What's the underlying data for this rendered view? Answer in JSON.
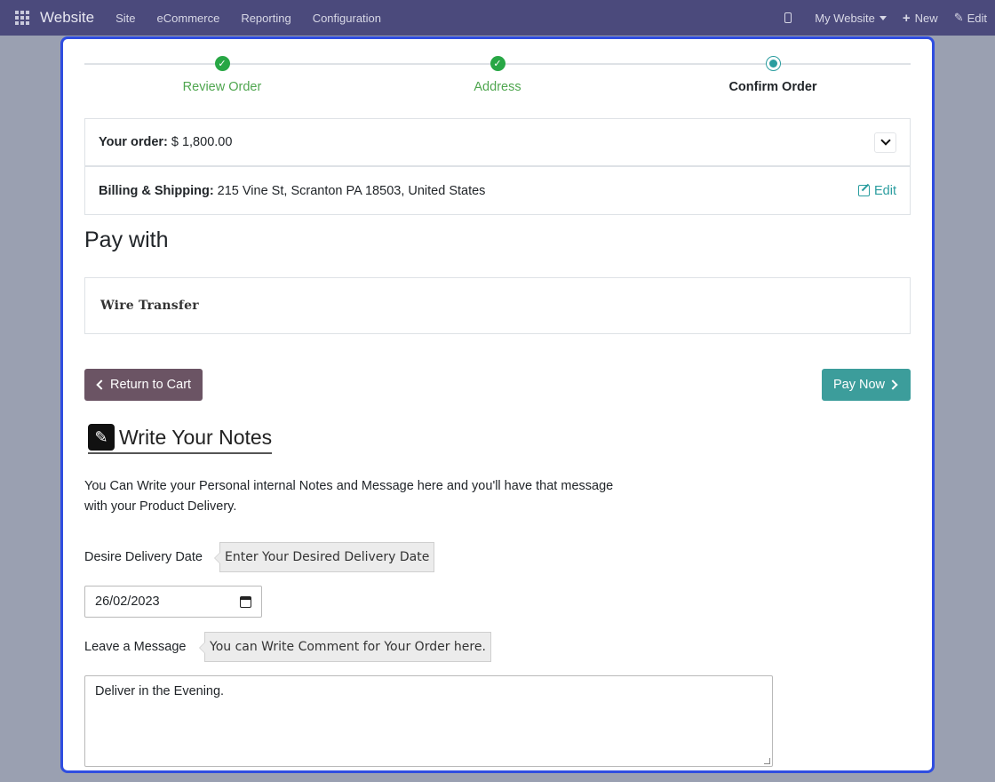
{
  "navbar": {
    "brand": "Website",
    "items": [
      "Site",
      "eCommerce",
      "Reporting",
      "Configuration"
    ],
    "website_selector": "My Website",
    "new_label": "New",
    "edit_label": "Edit"
  },
  "wizard": {
    "steps": [
      {
        "label": "Review Order",
        "state": "done"
      },
      {
        "label": "Address",
        "state": "done"
      },
      {
        "label": "Confirm Order",
        "state": "current"
      }
    ]
  },
  "order": {
    "label": "Your order:",
    "amount": "$ 1,800.00"
  },
  "billing": {
    "label": "Billing & Shipping:",
    "address": "215 Vine St, Scranton PA 18503, United States",
    "edit_label": "Edit"
  },
  "payment": {
    "title": "Pay with",
    "method": "Wire Transfer"
  },
  "actions": {
    "return_label": "Return to Cart",
    "pay_label": "Pay Now"
  },
  "notes": {
    "title": "Write Your Notes",
    "description": "You Can Write your Personal internal Notes and Message here and you'll have that message with your Product Delivery.",
    "delivery_label": "Desire Delivery Date",
    "delivery_tip": "Enter Your Desired Delivery Date",
    "delivery_value": "26/02/2023",
    "message_label": "Leave a Message",
    "message_tip": "You can Write Comment for Your Order here.",
    "message_value": "Deliver in the Evening."
  },
  "colors": {
    "navbar": "#4b4a7c",
    "accent": "#2a9d9f",
    "done": "#28a745",
    "return_button": "#6b5464",
    "panel_border": "#2f4de0"
  }
}
